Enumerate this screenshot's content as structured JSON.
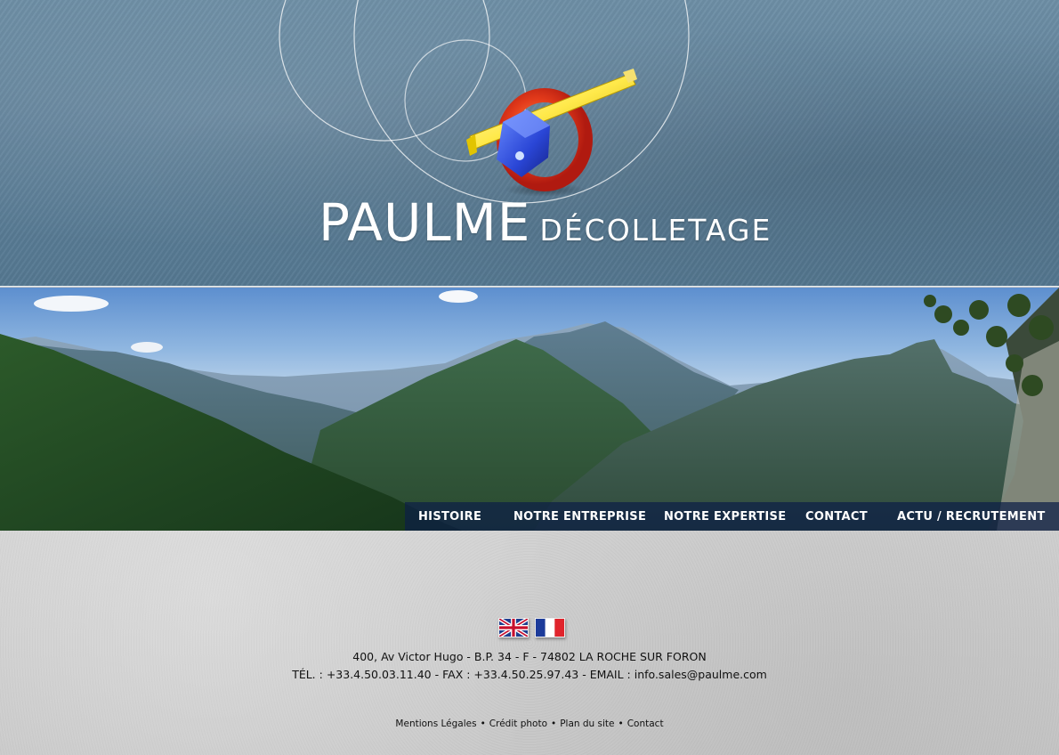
{
  "header": {
    "brand_main": "PAULME",
    "brand_sub": "DÉCOLLETAGE"
  },
  "nav": {
    "items": [
      {
        "label": "HISTOIRE"
      },
      {
        "label": "NOTRE ENTREPRISE"
      },
      {
        "label": "NOTRE EXPERTISE"
      },
      {
        "label": "CONTACT"
      },
      {
        "label": "ACTU / RECRUTEMENT"
      }
    ]
  },
  "languages": [
    {
      "code": "en",
      "icon": "uk-flag-icon"
    },
    {
      "code": "fr",
      "icon": "france-flag-icon"
    }
  ],
  "footer": {
    "address": "400, Av Victor Hugo - B.P. 34 - F - 74802 LA ROCHE SUR FORON",
    "contact_line": "TÉL. : +33.4.50.03.11.40  - FAX : +33.4.50.25.97.43 - EMAIL : info.sales@paulme.com",
    "links": [
      "Mentions Légales",
      "Crédit photo",
      "Plan du site",
      "Contact"
    ],
    "separator": "•"
  }
}
